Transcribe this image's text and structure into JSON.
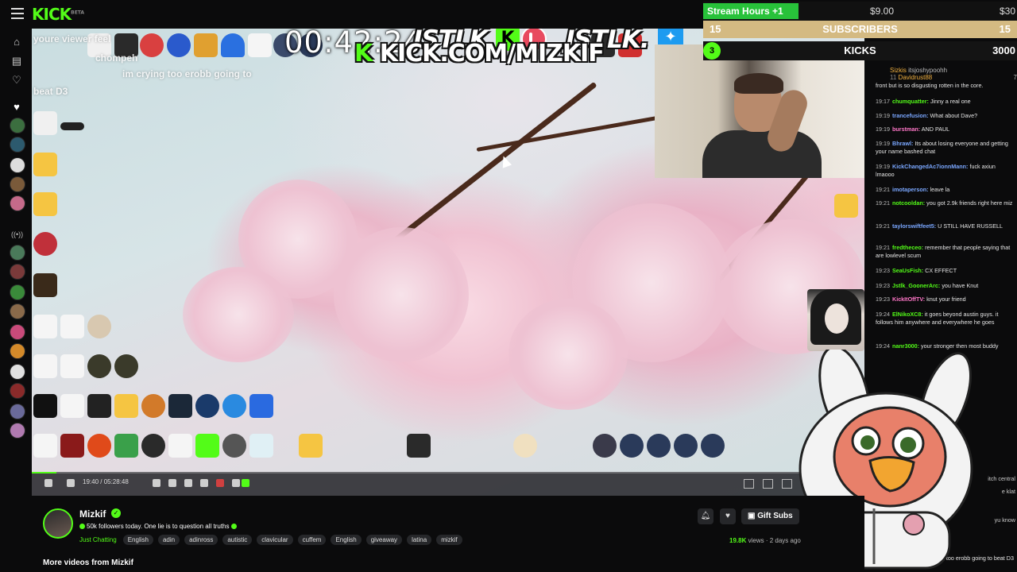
{
  "header": {
    "logo": "KICK",
    "logo_sup": "BETA"
  },
  "overlay": {
    "timer": "00:42:24",
    "brand_left": "JSTLK",
    "brand_right": "JSTLK.",
    "brand_k": "K",
    "kick_url_k": "K",
    "kick_url": "KICK.COM/MIZKIF",
    "ghost_line1": "youre viewer feel",
    "ghost_line2": "chompeh",
    "ghost_line3": "im crying too erobb going to",
    "ghost_line4": "beat D3",
    "stream_hours_label": "Stream Hours +1",
    "stream_hours_mid": "$9.00",
    "stream_hours_right": "$30",
    "subs_left": "15",
    "subs_label": "SUBSCRIBERS",
    "subs_right": "15",
    "kicks_badge": "3",
    "kicks_label": "KICKS",
    "kicks_right": "3000",
    "player_time": "19:40 / 05:28:48",
    "progress": 0.03
  },
  "chat": {
    "top_snip": "sandy-fragey",
    "gifter1": "Sizkis",
    "gifter1_count": "11",
    "gifter2": "itsjoshypoohh",
    "gifter3": "Davidrust88",
    "gifter3_count": "7",
    "messages": [
      {
        "ts": "",
        "user": "",
        "color": "#e6e6e6",
        "text": "front but is so disgusting rotten in the core."
      },
      {
        "ts": "19:17",
        "user": "chumquatter:",
        "color": "#53fc18",
        "text": "Jinny a real one"
      },
      {
        "ts": "19:19",
        "user": "trancefusion:",
        "color": "#7aa7ff",
        "text": "What about Dave?"
      },
      {
        "ts": "19:19",
        "user": "burstman:",
        "color": "#ff77c8",
        "text": "AND PAUL"
      },
      {
        "ts": "19:19",
        "user": "Bhrawl:",
        "color": "#7aa7ff",
        "text": "Its about losing everyone and getting your name bashed chat"
      },
      {
        "ts": "19:19",
        "user": "KickChangedAc7ionnMann:",
        "color": "#7aa7ff",
        "text": "fuck axiun lmaooo"
      },
      {
        "ts": "19:21",
        "user": "imotaperson:",
        "color": "#7aa7ff",
        "text": "leave la"
      },
      {
        "ts": "19:21",
        "user": "notcooldan:",
        "color": "#53fc18",
        "text": "you got 2.9k friends right here miz"
      },
      {
        "ts": "19:21",
        "user": "taylorswiftfeet5:",
        "color": "#7aa7ff",
        "text": "U STILL HAVE RUSSELL"
      },
      {
        "ts": "19:21",
        "user": "fredtheceo:",
        "color": "#53fc18",
        "text": "remember that people saying that are lowlevel scum"
      },
      {
        "ts": "19:23",
        "user": "SeaUsFish:",
        "color": "#53fc18",
        "text": "CX EFFECT"
      },
      {
        "ts": "19:23",
        "user": "Jstlk_GoonerArc:",
        "color": "#53fc18",
        "text": "you have Knut"
      },
      {
        "ts": "19:23",
        "user": "KickItOffTV:",
        "color": "#ff77c8",
        "text": "knut your friend"
      },
      {
        "ts": "19:24",
        "user": "ElNikoXC8:",
        "color": "#53fc18",
        "text": "it goes beyond austin guys. it follows him anywhere and everywhere he goes"
      },
      {
        "ts": "19:24",
        "user": "nanr3000:",
        "color": "#53fc18",
        "text": "your stronger then most buddy"
      }
    ],
    "partial1": "itch central",
    "partial2": "e klat",
    "partial3": "yu know",
    "last_msg": "crying too erobb going to beat D3"
  },
  "channel": {
    "name": "Mizkif",
    "title": "50k followers today. One lie is to question all truths",
    "category": "Just Chatting",
    "tags": [
      "English",
      "adin",
      "adinross",
      "autistic",
      "clavicular",
      "cuffem",
      "English",
      "giveaway",
      "latina",
      "mizkif"
    ],
    "gift_subs": "Gift Subs",
    "views": "19.8K",
    "views_suffix": "views",
    "age": "2 days ago",
    "more_videos": "More videos from Mizkif"
  },
  "icons": {
    "bell": "bell-icon",
    "heart": "heart-icon",
    "gift": "gift-icon"
  }
}
